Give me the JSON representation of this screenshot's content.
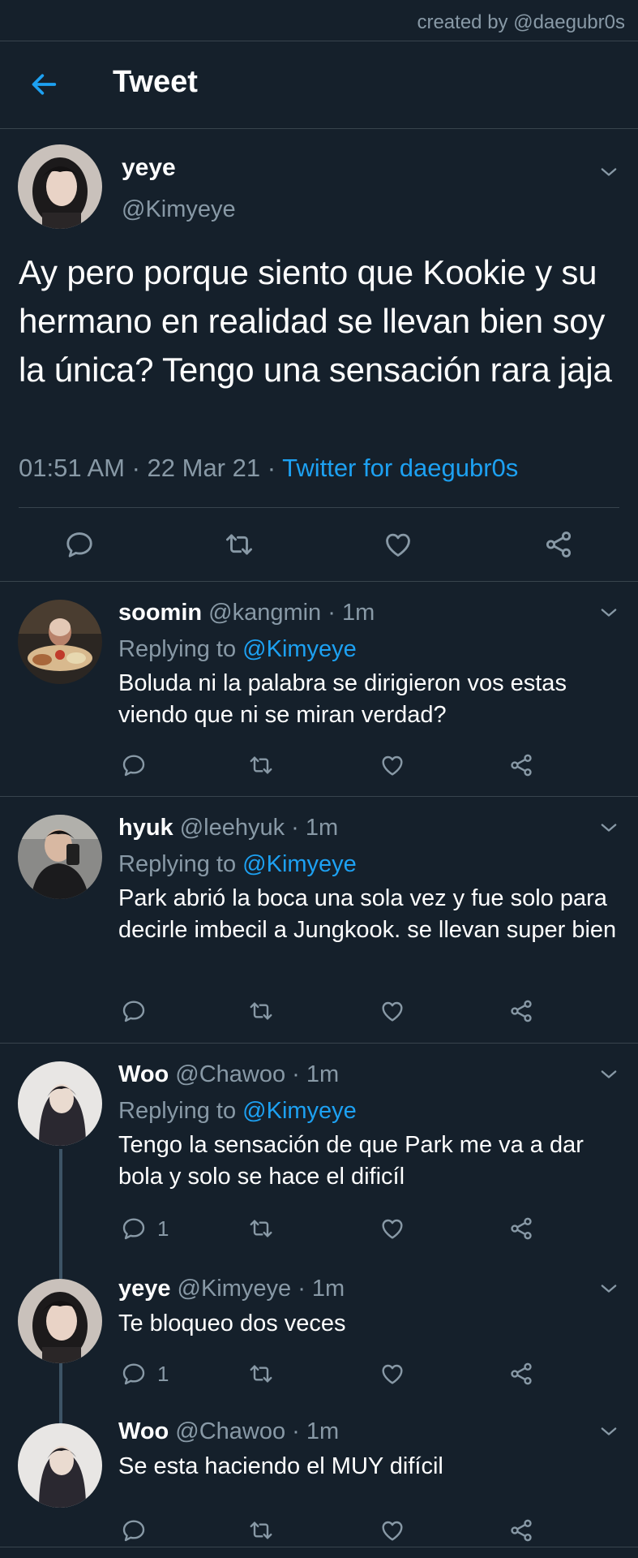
{
  "credit": "created by @daegubr0s",
  "header": {
    "title": "Tweet"
  },
  "main_tweet": {
    "name": "yeye",
    "handle": "@Kimyeye",
    "text": "Ay pero porque siento que Kookie y su hermano en realidad se llevan bien soy la única? Tengo una sensación rara jaja",
    "time": "01:51 AM · 22 Mar 21 · ",
    "source": "Twitter for daegubr0s"
  },
  "replies": [
    {
      "name": "soomin",
      "handle": "@kangmin · 1m",
      "replying_label": "Replying to ",
      "replying_to": "@Kimyeye",
      "text": "Boluda ni la palabra se dirigieron vos estas viendo que ni se miran verdad?",
      "reply_count": ""
    },
    {
      "name": "hyuk",
      "handle": "@leehyuk · 1m",
      "replying_label": "Replying to ",
      "replying_to": "@Kimyeye",
      "text": "Park abrió la boca una sola vez y fue solo para decirle imbecil a Jungkook. se llevan super bien",
      "reply_count": ""
    },
    {
      "name": "Woo",
      "handle": "@Chawoo · 1m",
      "replying_label": "Replying to ",
      "replying_to": "@Kimyeye",
      "text": "Tengo la sensación de que Park me va a dar bola y solo se hace el dificíl",
      "reply_count": "1"
    },
    {
      "name": "yeye",
      "handle": "@Kimyeye · 1m",
      "text": "Te bloqueo dos veces",
      "reply_count": "1"
    },
    {
      "name": "Woo",
      "handle": "@Chawoo · 1m",
      "text": "Se esta haciendo el MUY difícil",
      "reply_count": ""
    }
  ],
  "colors": {
    "background": "#15202b",
    "accent": "#1da1f2",
    "muted": "#8899a6",
    "divider": "#38444d"
  },
  "icons": [
    "back-arrow-icon",
    "chevron-down-icon",
    "reply-icon",
    "retweet-icon",
    "like-icon",
    "share-icon"
  ]
}
